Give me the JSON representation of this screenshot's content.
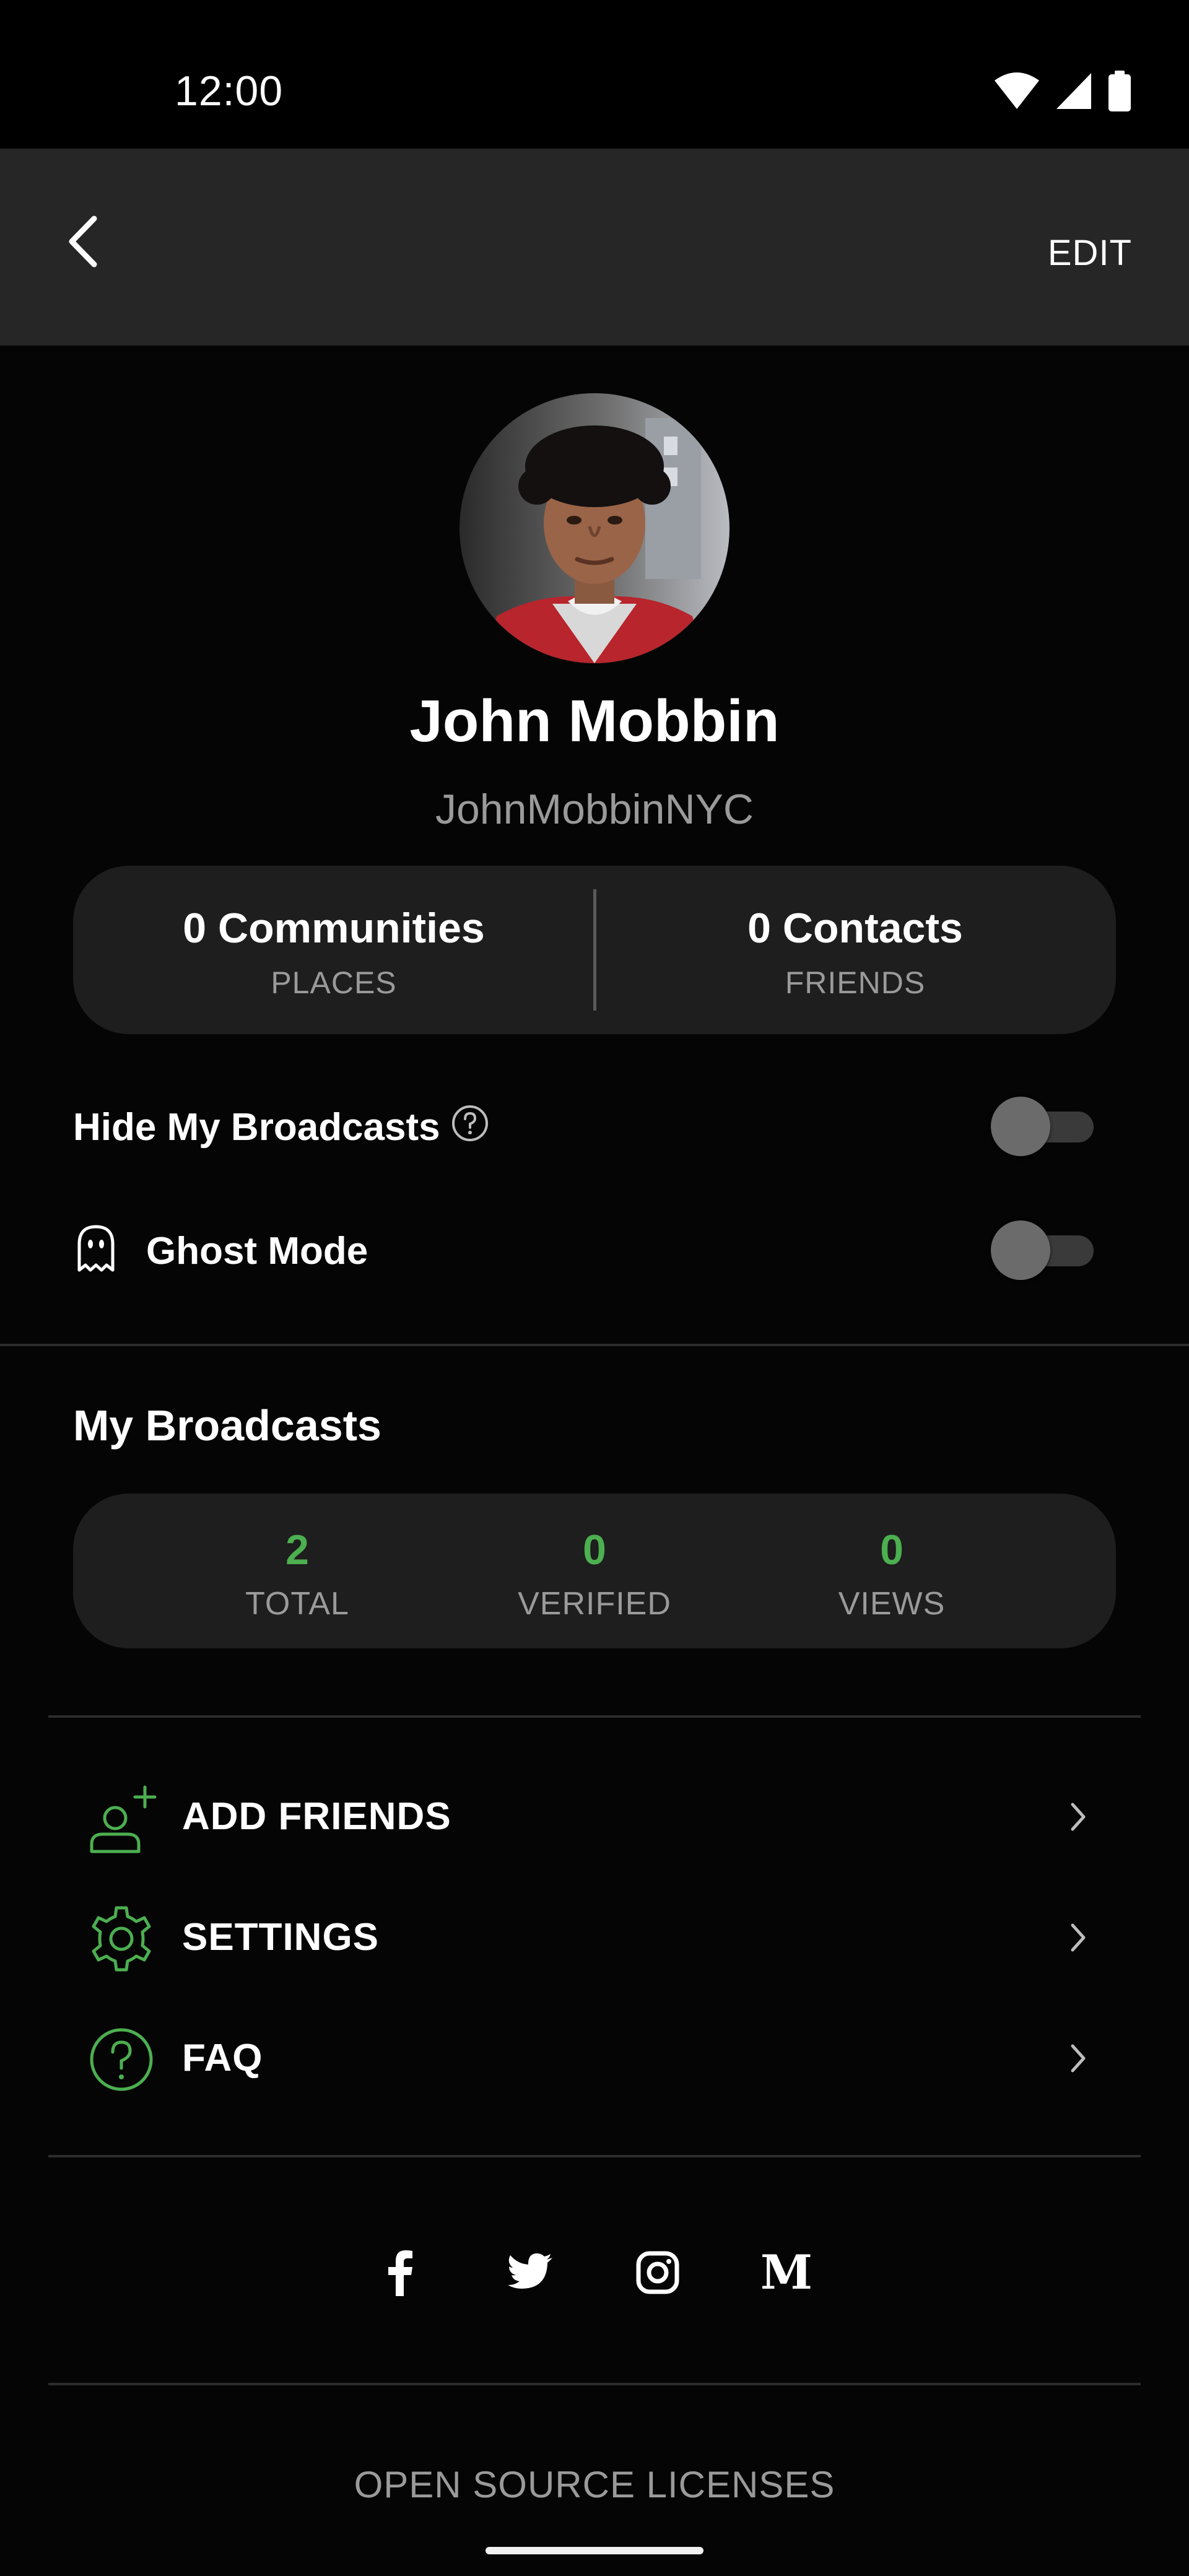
{
  "status_bar": {
    "time": "12:00"
  },
  "app_bar": {
    "back_icon": "chevron-left-icon",
    "edit_label": "EDIT"
  },
  "profile": {
    "name": "John Mobbin",
    "handle": "JohnMobbinNYC"
  },
  "stats": [
    {
      "value": "0 Communities",
      "label": "PLACES"
    },
    {
      "value": "0 Contacts",
      "label": "FRIENDS"
    }
  ],
  "settings": {
    "hide_broadcasts": {
      "label": "Hide My Broadcasts",
      "enabled": false,
      "help_icon": "question-circle-icon"
    },
    "ghost_mode": {
      "label": "Ghost Mode",
      "enabled": false,
      "icon": "ghost-icon"
    }
  },
  "broadcasts": {
    "title": "My Broadcasts",
    "stats": [
      {
        "value": "2",
        "label": "TOTAL"
      },
      {
        "value": "0",
        "label": "VERIFIED"
      },
      {
        "value": "0",
        "label": "VIEWS"
      }
    ]
  },
  "menu": [
    {
      "label": "ADD FRIENDS",
      "icon": "add-user-icon"
    },
    {
      "label": "SETTINGS",
      "icon": "gear-icon"
    },
    {
      "label": "FAQ",
      "icon": "question-circle-icon"
    }
  ],
  "social": [
    "facebook-icon",
    "twitter-icon",
    "instagram-icon",
    "medium-icon"
  ],
  "footer": {
    "licenses_label": "OPEN SOURCE LICENSES"
  },
  "colors": {
    "accent_green": "#4caf50",
    "background": "#050505",
    "card": "#1e1e1e",
    "app_bar": "#262626",
    "muted_text": "#9a9a9a"
  }
}
